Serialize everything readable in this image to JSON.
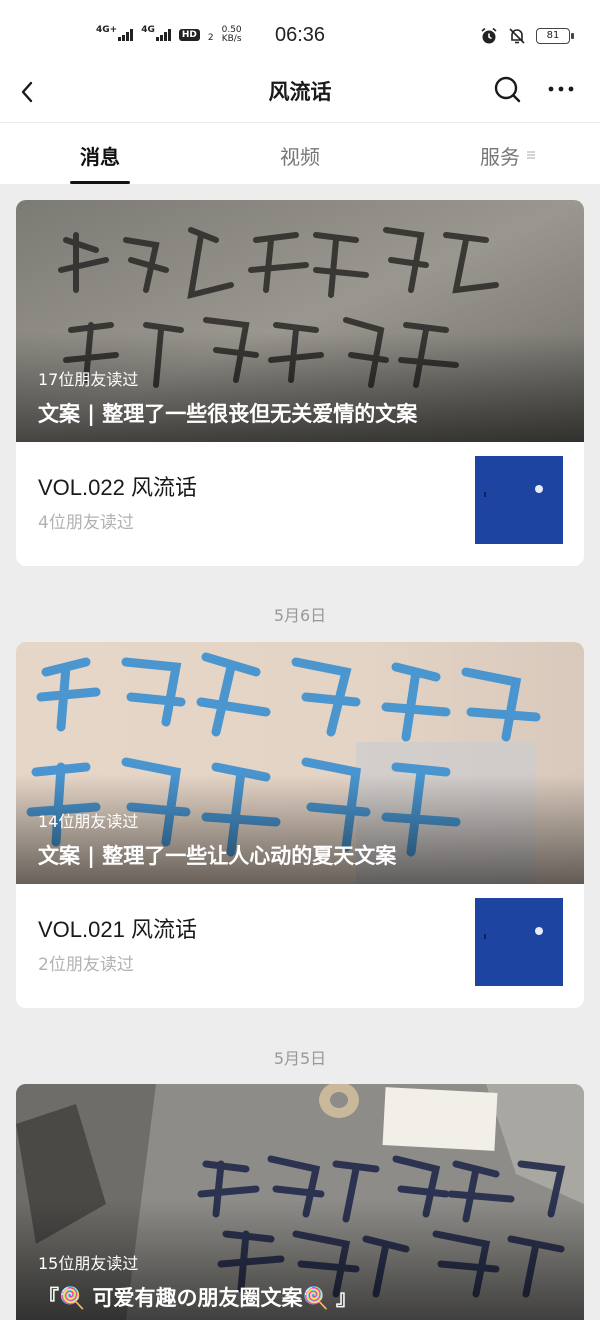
{
  "status_bar": {
    "network_1": "4G+",
    "network_2": "4G",
    "hd": "HD",
    "hd_sub": "2",
    "speed_value": "0.50",
    "speed_unit": "KB/s",
    "time": "06:36",
    "battery": "81"
  },
  "nav": {
    "title": "风流话",
    "back_icon": "chevron-left-icon",
    "search_icon": "search-icon",
    "more_icon": "more-horizontal-icon"
  },
  "tabs": [
    {
      "label": "消息",
      "active": true
    },
    {
      "label": "视频",
      "active": false
    },
    {
      "label": "服务",
      "active": false
    }
  ],
  "feed": [
    {
      "cover": {
        "readers": "17位朋友读过",
        "title": "文案 | 整理了一些很丧但无关爱情的文案",
        "image_text": "我知道我可能 当不了原作了"
      },
      "sub": {
        "title": "VOL.022 风流话",
        "readers": "4位朋友读过"
      }
    },
    {
      "date": "5月6日",
      "cover": {
        "readers": "14位朋友读过",
        "title": "文案 | 整理了一些让人心动的夏天文案",
        "image_text": "你是我永远 期待的夏天"
      },
      "sub": {
        "title": "VOL.021 风流话",
        "readers": "2位朋友读过"
      }
    },
    {
      "date": "5月5日",
      "cover": {
        "readers": "15位朋友读过",
        "title": "『🍭 可爱有趣の朋友圈文案🍭 』",
        "image_text": "我会死在无人 没有墓 风吹起"
      }
    }
  ],
  "colors": {
    "background": "#ededed",
    "thumb_blue": "#1e44a2",
    "muted_text": "#b2b2b2"
  }
}
